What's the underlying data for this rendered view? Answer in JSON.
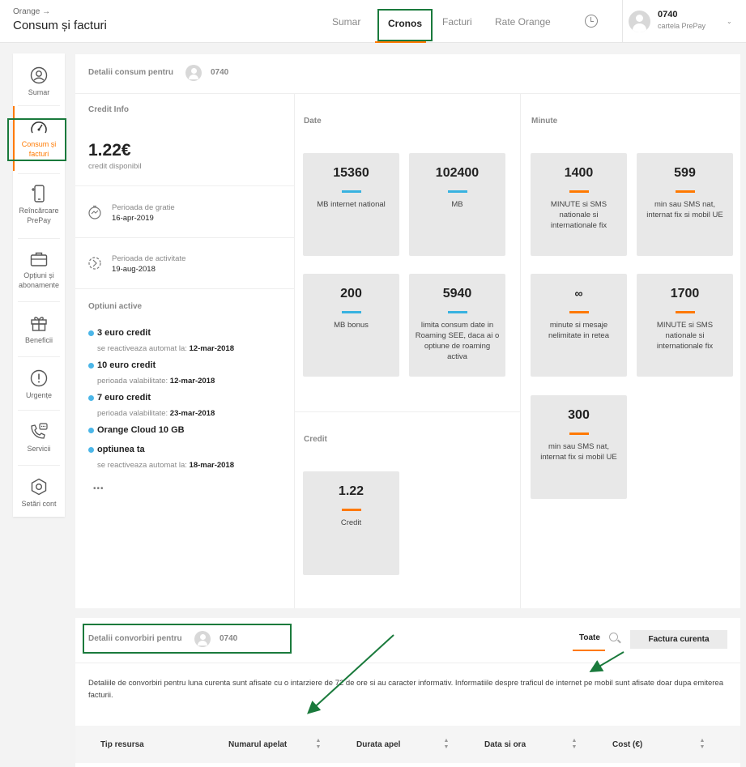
{
  "header": {
    "breadcrumb": "Orange →",
    "title": "Consum și facturi",
    "tabs": [
      "Sumar",
      "Cronos",
      "Facturi",
      "Rate Orange"
    ],
    "account_number": "0740",
    "account_type": "cartela PrePay"
  },
  "sidebar": {
    "items": [
      {
        "label": "Sumar",
        "icon": "user-circle-icon"
      },
      {
        "label": "Consum și facturi",
        "icon": "gauge-icon"
      },
      {
        "label": "Reîncărcare PrePay",
        "icon": "phone-topup-icon"
      },
      {
        "label": "Opțiuni și abonamente",
        "icon": "briefcase-icon"
      },
      {
        "label": "Beneficii",
        "icon": "gift-icon"
      },
      {
        "label": "Urgențe",
        "icon": "alert-icon"
      },
      {
        "label": "Servicii",
        "icon": "phone-chat-icon"
      },
      {
        "label": "Setări cont",
        "icon": "settings-hex-icon"
      }
    ]
  },
  "details": {
    "header_label": "Detalii consum pentru",
    "number": "0740"
  },
  "credit_info": {
    "title": "Credit Info",
    "amount": "1.22€",
    "amount_label": "credit disponibil",
    "grace_label": "Perioada de gratie",
    "grace_date": "16-apr-2019",
    "activity_label": "Perioada de activitate",
    "activity_date": "19-aug-2018"
  },
  "active_options": {
    "title": "Optiuni active",
    "items": [
      {
        "name": "3 euro credit",
        "sub": "se reactiveaza automat la:",
        "date": "12-mar-2018"
      },
      {
        "name": "10 euro credit",
        "sub": "perioada valabilitate:",
        "date": "12-mar-2018"
      },
      {
        "name": "7 euro credit",
        "sub": "perioada valabilitate:",
        "date": "23-mar-2018"
      },
      {
        "name": "Orange Cloud 10 GB",
        "sub": "",
        "date": ""
      },
      {
        "name": "optiunea ta",
        "sub": "se reactiveaza automat la:",
        "date": "18-mar-2018"
      }
    ],
    "more": "•••"
  },
  "date_section": {
    "title": "Date",
    "cards": [
      {
        "value": "15360",
        "label": "MB internet national"
      },
      {
        "value": "102400",
        "label": "MB"
      },
      {
        "value": "200",
        "label": "MB bonus"
      },
      {
        "value": "5940",
        "label": "limita consum date in Roaming SEE, daca ai o optiune de roaming activa"
      }
    ]
  },
  "credit_section": {
    "title": "Credit",
    "card": {
      "value": "1.22",
      "label": "Credit"
    }
  },
  "minute_section": {
    "title": "Minute",
    "cards": [
      {
        "value": "1400",
        "label": "MINUTE si SMS nationale si internationale fix"
      },
      {
        "value": "599",
        "label": "min sau SMS nat, internat fix si mobil UE"
      },
      {
        "value": "∞",
        "label": "minute si mesaje nelimitate in retea"
      },
      {
        "value": "1700",
        "label": "MINUTE si SMS nationale si internationale fix"
      },
      {
        "value": "300",
        "label": "min sau SMS nat, internat fix si mobil UE"
      }
    ]
  },
  "calls": {
    "header_label": "Detalii convorbiri pentru",
    "number": "0740",
    "filter_all": "Toate",
    "invoice_button": "Factura curenta",
    "info": "Detaliile de convorbiri pentru luna curenta sunt afisate cu o intarziere de 72 de ore si au caracter informativ. Informatiile despre traficul de internet pe mobil sunt afisate doar dupa emiterea facturii.",
    "columns": [
      "Tip resursa",
      "Numarul apelat",
      "Durata apel",
      "Data si ora",
      "Cost (€)"
    ]
  },
  "colors": {
    "accent": "#ff7900",
    "data_bar": "#38b2e0",
    "annotation_green": "#1a7a3c"
  }
}
